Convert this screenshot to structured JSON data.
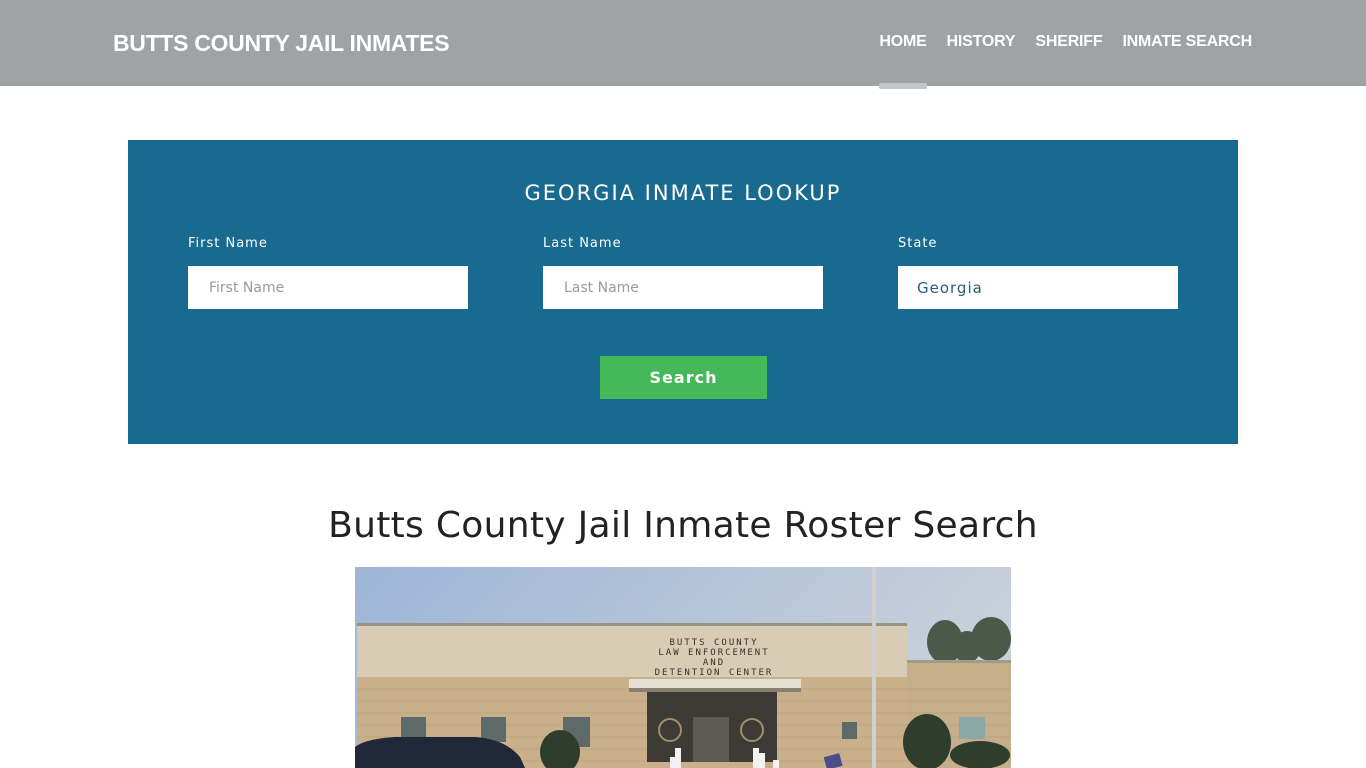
{
  "header": {
    "brand": "BUTTS COUNTY JAIL INMATES",
    "nav": [
      {
        "label": "HOME",
        "active": true
      },
      {
        "label": "HISTORY",
        "active": false
      },
      {
        "label": "SHERIFF",
        "active": false
      },
      {
        "label": "INMATE SEARCH",
        "active": false
      }
    ]
  },
  "lookup": {
    "title": "GEORGIA INMATE LOOKUP",
    "first_name": {
      "label": "First Name",
      "placeholder": "First Name",
      "value": ""
    },
    "last_name": {
      "label": "Last Name",
      "placeholder": "Last Name",
      "value": ""
    },
    "state": {
      "label": "State",
      "selected": "Georgia"
    },
    "search_label": "Search"
  },
  "main": {
    "title": "Butts County Jail Inmate Roster Search",
    "photo": {
      "description": "Butts County Law Enforcement and Detention Center building exterior",
      "sign_lines": [
        "BUTTS COUNTY",
        "LAW ENFORCEMENT",
        "AND",
        "DETENTION CENTER"
      ]
    }
  },
  "colors": {
    "navbar": "#9fa3a6",
    "panel": "#186a8e",
    "search_button": "#45b85a",
    "active_indicator": "#c2c4c6"
  }
}
